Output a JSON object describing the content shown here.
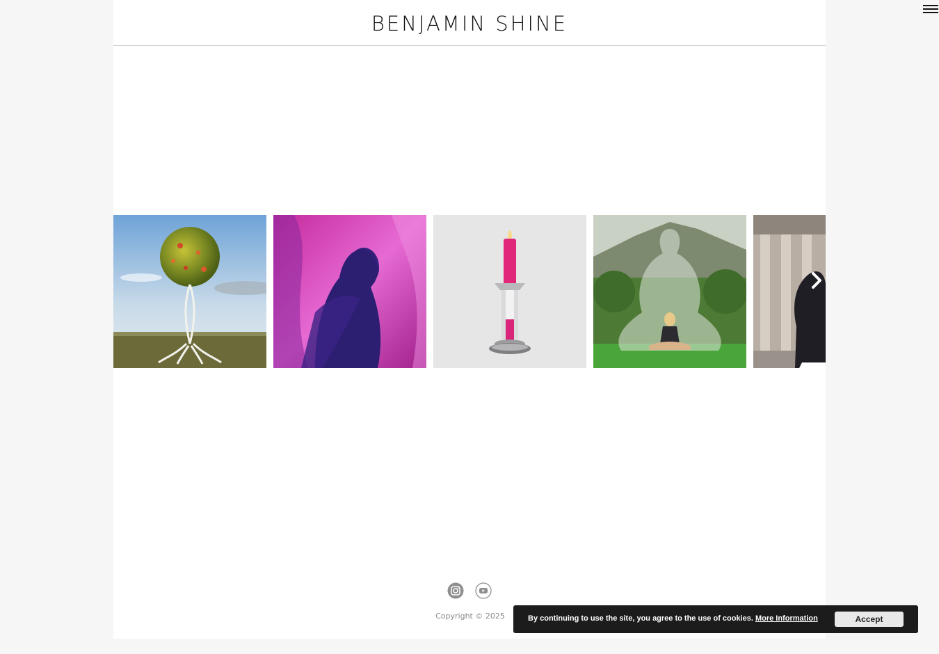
{
  "header": {
    "logo_text": "BENJAMIN SHINE",
    "menu_icon": "hamburger-menu-icon"
  },
  "carousel": {
    "next_icon": "chevron-right-icon",
    "items": [
      {
        "image": "sphere-sculpture-landscape-image",
        "caption": ""
      },
      {
        "image": "pink-tulle-silhouette-image",
        "caption": ""
      },
      {
        "image": "pink-candle-sculpture-image",
        "caption": ""
      },
      {
        "image": "meditation-hedge-sculpture-image",
        "caption": ""
      },
      {
        "image": "black-horse-sculpture-museum-image",
        "caption": ""
      }
    ]
  },
  "footer": {
    "social_icons": [
      "instagram-icon",
      "youtube-icon"
    ],
    "copyright": "Copyright © 2025"
  },
  "cookie_banner": {
    "message": "By continuing to use the site, you agree to the use of cookies.",
    "more_info_label": "More Information",
    "accept_label": "Accept"
  },
  "colors": {
    "background": "#f6f6f6",
    "page": "#ffffff",
    "cookie_banner": "#1c1c1c",
    "accept_button": "#e9e9e9"
  }
}
